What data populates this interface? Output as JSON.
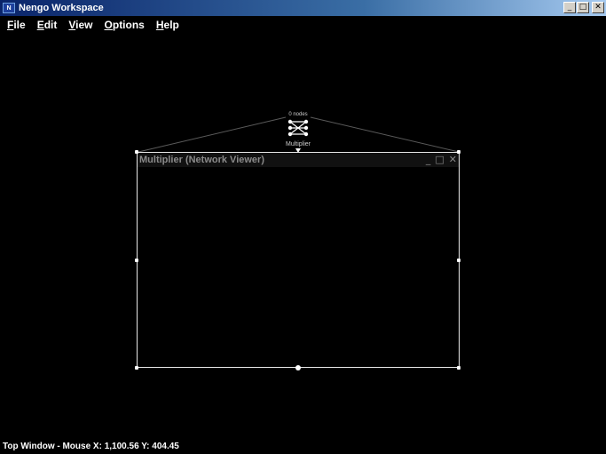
{
  "window": {
    "title": "Nengo Workspace",
    "icon_text": "N",
    "controls": {
      "minimize": "_",
      "maximize": "□",
      "close": "✕"
    }
  },
  "menu": {
    "items": [
      {
        "label": "File"
      },
      {
        "label": "Edit"
      },
      {
        "label": "View"
      },
      {
        "label": "Options"
      },
      {
        "label": "Help"
      }
    ]
  },
  "canvas": {
    "node": {
      "top_label": "0 nodes",
      "name": "Multiplier",
      "icon": "network-icon"
    },
    "viewer": {
      "title": "Multiplier (Network Viewer)",
      "controls": {
        "minimize": "_",
        "maximize": "□",
        "close": "✕"
      }
    }
  },
  "status": {
    "text": "Top Window - Mouse X: 1,100.56 Y: 404.45"
  },
  "colors": {
    "background": "#000000",
    "titlebar_start": "#0a246a",
    "titlebar_end": "#a6caf0",
    "frame": "#e8e8e8",
    "wire": "#5a5a5a"
  }
}
